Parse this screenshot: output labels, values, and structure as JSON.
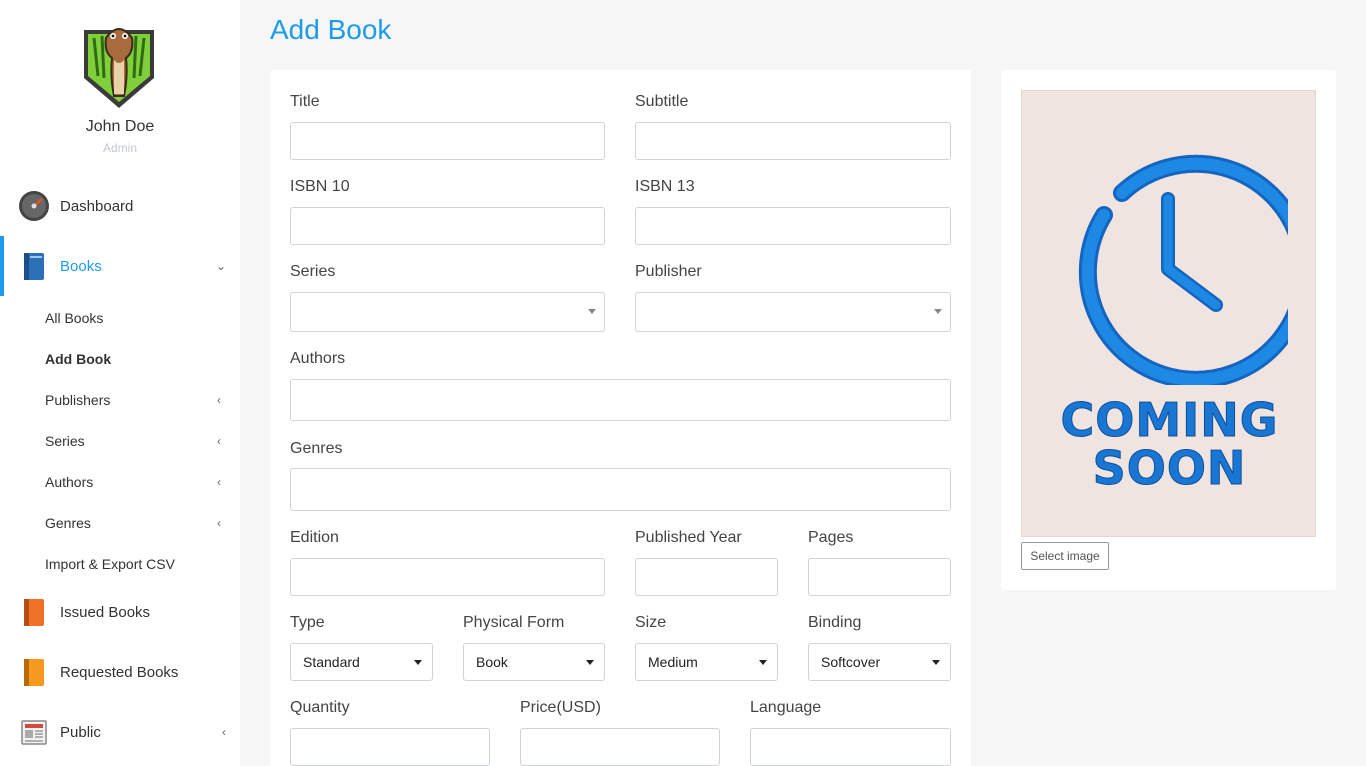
{
  "user": {
    "name": "John Doe",
    "role": "Admin"
  },
  "nav": {
    "dashboard": "Dashboard",
    "books": "Books",
    "books_sub": [
      "All Books",
      "Add Book",
      "Publishers",
      "Series",
      "Authors",
      "Genres",
      "Import & Export CSV"
    ],
    "issued": "Issued Books",
    "requested": "Requested Books",
    "public": "Public"
  },
  "page": {
    "title": "Add Book"
  },
  "form": {
    "title": "Title",
    "subtitle": "Subtitle",
    "isbn10": "ISBN 10",
    "isbn13": "ISBN 13",
    "series": "Series",
    "publisher": "Publisher",
    "authors": "Authors",
    "genres": "Genres",
    "edition": "Edition",
    "published_year": "Published Year",
    "pages": "Pages",
    "type": {
      "label": "Type",
      "value": "Standard"
    },
    "physical_form": {
      "label": "Physical Form",
      "value": "Book"
    },
    "size": {
      "label": "Size",
      "value": "Medium"
    },
    "binding": {
      "label": "Binding",
      "value": "Softcover"
    },
    "quantity": "Quantity",
    "price": "Price(USD)",
    "language": "Language"
  },
  "cover": {
    "line1": "COMING",
    "line2": "SOON",
    "button": "Select image"
  },
  "colors": {
    "accent": "#1e9bea",
    "cover_bg": "#efe4df",
    "cover_blue": "#1976d2"
  }
}
